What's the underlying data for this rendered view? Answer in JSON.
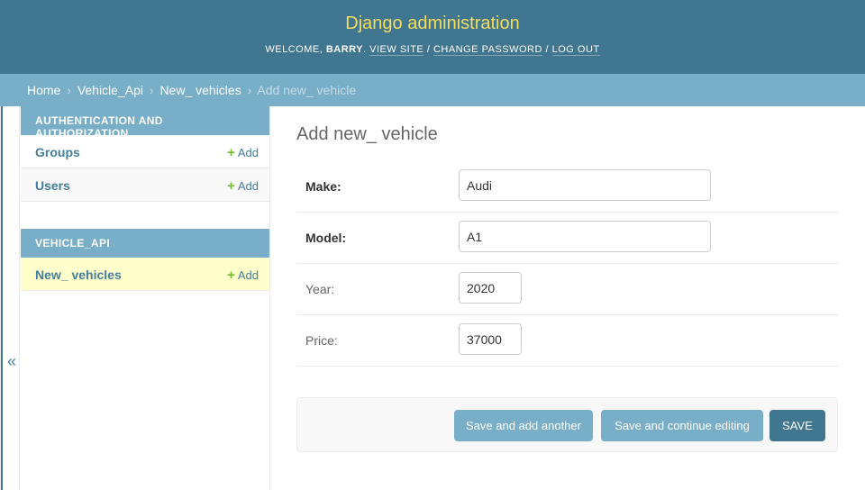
{
  "header": {
    "site_name": "Django administration",
    "welcome_prefix": "WELCOME, ",
    "username": "BARRY",
    "welcome_suffix": ". ",
    "view_site": "VIEW SITE",
    "change_password": "CHANGE PASSWORD",
    "log_out": "LOG OUT",
    "separator": " / "
  },
  "breadcrumbs": {
    "home": "Home",
    "app": "Vehicle_Api",
    "model": "New_ vehicles",
    "current": "Add new_ vehicle",
    "separator": "›"
  },
  "nav_toggle": {
    "icon": "«"
  },
  "sidebar": {
    "modules": [
      {
        "caption": "AUTHENTICATION AND AUTHORIZATION",
        "items": [
          {
            "name": "Groups",
            "add": "Add"
          },
          {
            "name": "Users",
            "add": "Add"
          }
        ]
      },
      {
        "caption": "VEHICLE_API",
        "items": [
          {
            "name": "New_ vehicles",
            "add": "Add"
          }
        ]
      }
    ],
    "plus_icon": "+"
  },
  "content": {
    "title": "Add new_ vehicle",
    "fields": [
      {
        "label": "Make:",
        "value": "Audi",
        "required": true
      },
      {
        "label": "Model:",
        "value": "A1",
        "required": true
      },
      {
        "label": "Year:",
        "value": "2020",
        "required": false
      },
      {
        "label": "Price:",
        "value": "37000",
        "required": false
      }
    ],
    "buttons": {
      "save_add_another": "Save and add another",
      "save_continue": "Save and continue editing",
      "save": "SAVE"
    }
  },
  "colors": {
    "header_bg": "#417690",
    "site_name": "#f5dd5d",
    "breadcrumbs_bg": "#79aec8",
    "link": "#447e9b",
    "add_plus": "#70bf2b",
    "current_row": "#ffffcc"
  }
}
